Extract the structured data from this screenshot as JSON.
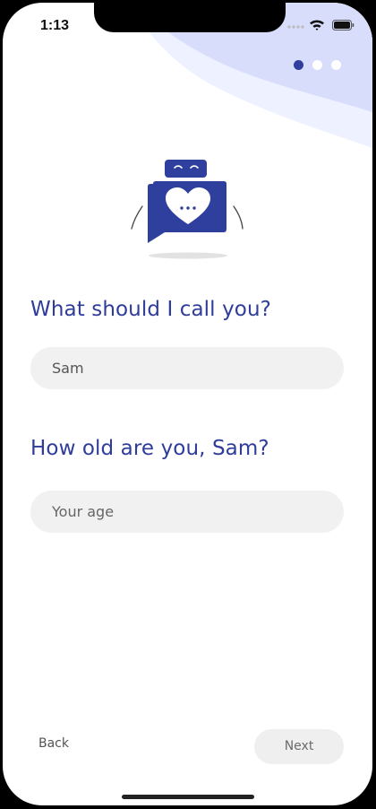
{
  "status_bar": {
    "time": "1:13"
  },
  "onboarding": {
    "steps_total": 3,
    "current_step": 1
  },
  "form": {
    "name_question": "What should I call you?",
    "name_value": "Sam",
    "age_question": "How old are you, Sam?",
    "age_placeholder": "Your age",
    "age_value": ""
  },
  "nav": {
    "back_label": "Back",
    "next_label": "Next"
  },
  "colors": {
    "accent": "#2f3f9e",
    "wave": "#d7ddfb",
    "field_bg": "#f1f1f1"
  },
  "icons": [
    "wifi-icon",
    "cellular-icon",
    "battery-icon",
    "robot-heart-icon"
  ]
}
